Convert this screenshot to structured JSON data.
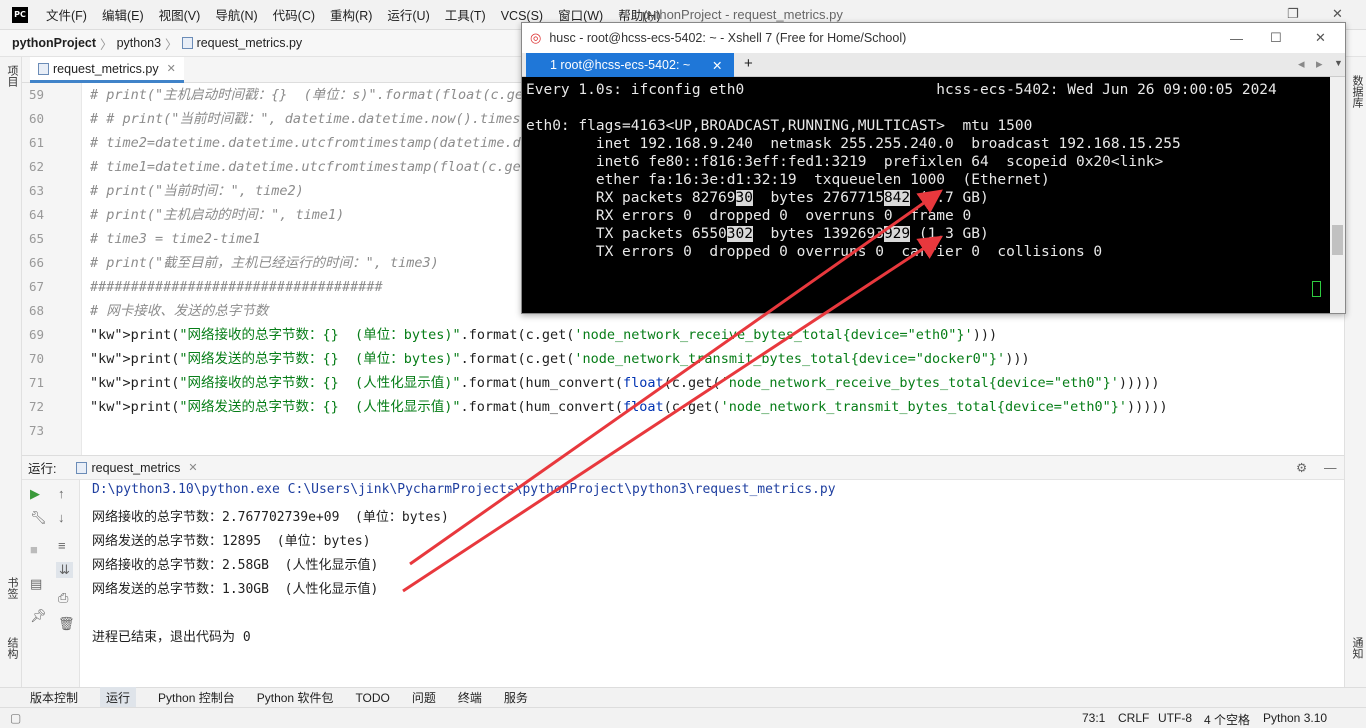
{
  "menu": [
    "文件(F)",
    "编辑(E)",
    "视图(V)",
    "导航(N)",
    "代码(C)",
    "重构(R)",
    "运行(U)",
    "工具(T)",
    "VCS(S)",
    "窗口(W)",
    "帮助(H)"
  ],
  "window_title": "pythonProject - request_metrics.py",
  "breadcrumb": [
    "pythonProject",
    "python3",
    "request_metrics.py"
  ],
  "left_tool": [
    "项目",
    "书签",
    "结构"
  ],
  "right_tool": [
    "数据库",
    "通知"
  ],
  "editor_tab": "request_metrics.py",
  "run_config": "request_metrics",
  "lines": [
    {
      "n": "59",
      "t": "# print(\"主机启动时间戳：{}  (单位：s)\".format(float(c.get("
    },
    {
      "n": "60",
      "t": "# # print(\"当前时间戳：\", datetime.datetime.now().timest"
    },
    {
      "n": "61",
      "t": "# time2=datetime.datetime.utcfromtimestamp(datetime.datetime.n"
    },
    {
      "n": "62",
      "t": "# time1=datetime.datetime.utcfromtimestamp(float(c.get('node_bo"
    },
    {
      "n": "63",
      "t": "# print(\"当前时间：\", time2)"
    },
    {
      "n": "64",
      "t": "# print(\"主机启动的时间：\", time1)"
    },
    {
      "n": "65",
      "t": "# time3 = time2-time1"
    },
    {
      "n": "66",
      "t": "# print(\"截至目前，主机已经运行的时间：\", time3)"
    },
    {
      "n": "67",
      "t": "####################################"
    },
    {
      "n": "68",
      "t": "# 网卡接收、发送的总字节数"
    },
    {
      "n": "69",
      "t": "print(\"网络接收的总字节数：{}  (单位：bytes)\".format(c.get('node_network_receive_bytes_total{device=\"eth0\"}')))"
    },
    {
      "n": "70",
      "t": "print(\"网络发送的总字节数：{}  (单位：bytes)\".format(c.get('node_network_transmit_bytes_total{device=\"docker0\"}')))"
    },
    {
      "n": "71",
      "t": "print(\"网络接收的总字节数：{}  (人性化显示值)\".format(hum_convert(float(c.get('node_network_receive_bytes_total{device=\"eth0\"}')))))"
    },
    {
      "n": "72",
      "t": "print(\"网络发送的总字节数：{}  (人性化显示值)\".format(hum_convert(float(c.get('node_network_transmit_bytes_total{device=\"eth0\"}')))))"
    },
    {
      "n": "73",
      "t": ""
    }
  ],
  "run_label": "运行:",
  "console": [
    "D:\\python3.10\\python.exe C:\\Users\\jink\\PycharmProjects\\pythonProject\\python3\\request_metrics.py",
    "网络接收的总字节数：2.767702739e+09  (单位：bytes)",
    "网络发送的总字节数：12895  (单位：bytes)",
    "网络接收的总字节数：2.58GB  (人性化显示值)",
    "网络发送的总字节数：1.30GB  (人性化显示值)",
    "",
    "进程已结束，退出代码为 0"
  ],
  "bottom_tabs": [
    "版本控制",
    "运行",
    "Python 控制台",
    "Python 软件包",
    "TODO",
    "问题",
    "终端",
    "服务"
  ],
  "status": {
    "pos": "73:1",
    "eol": "CRLF",
    "enc": "UTF-8",
    "indent": "4 个空格",
    "interp": "Python 3.10"
  },
  "xshell": {
    "title": "husc - root@hcss-ecs-5402: ~ - Xshell 7 (Free for Home/School)",
    "tab": "1 root@hcss-ecs-5402: ~",
    "lines": [
      "Every 1.0s: ifconfig eth0                      hcss-ecs-5402: Wed Jun 26 09:00:05 2024",
      "",
      "eth0: flags=4163<UP,BROADCAST,RUNNING,MULTICAST>  mtu 1500",
      "        inet 192.168.9.240  netmask 255.255.240.0  broadcast 192.168.15.255",
      "        inet6 fe80::f816:3eff:fed1:3219  prefixlen 64  scopeid 0x20<link>",
      "        ether fa:16:3e:d1:32:19  txqueuelen 1000  (Ethernet)",
      "        RX packets 8276930  bytes 2767715842 (2.7 GB)",
      "        RX errors 0  dropped 0  overruns 0  frame 0",
      "        TX packets 6550302  bytes 1392693929 (1.3 GB)",
      "        TX errors 0  dropped 0 overruns 0  carrier 0  collisions 0"
    ]
  },
  "colors": {
    "arrow": "#e8383d",
    "tab_accent": "#4083c9",
    "xshell_tab": "#1f77d8"
  }
}
